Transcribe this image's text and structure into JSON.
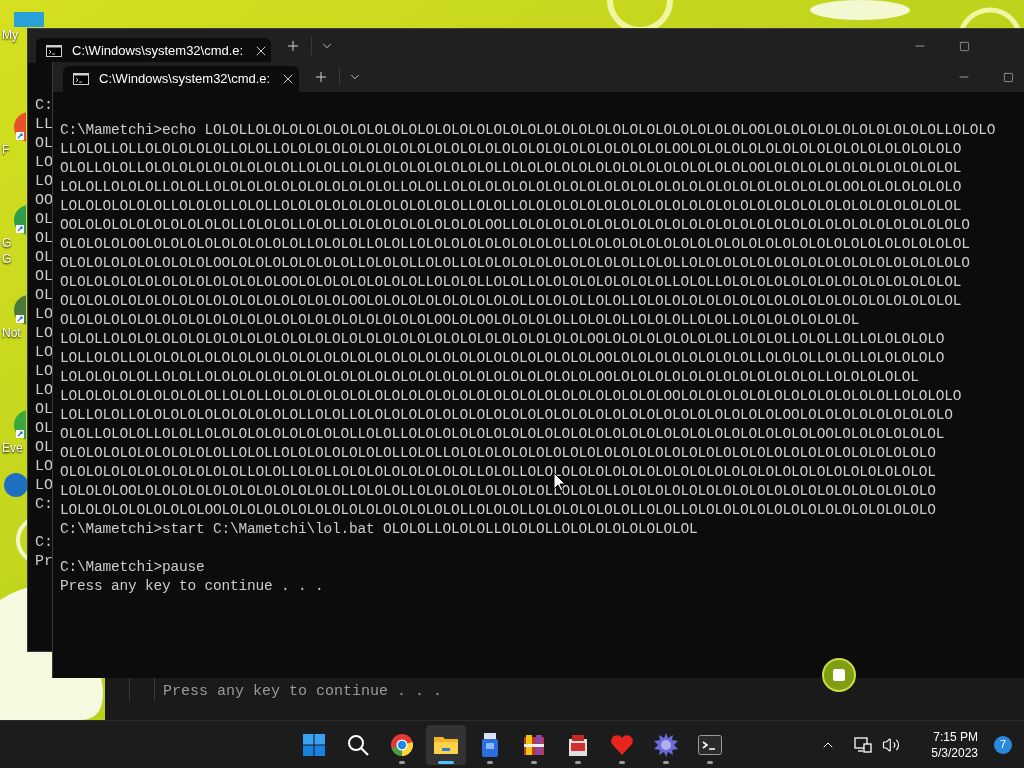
{
  "desktop": {
    "icons": [
      {
        "label": [
          "My"
        ]
      },
      {
        "label": [
          "F"
        ]
      },
      {
        "label": [
          "G",
          "G"
        ]
      },
      {
        "label": [
          "Not"
        ]
      },
      {
        "label": [
          "Eve"
        ]
      }
    ]
  },
  "windows": [
    {
      "tab": {
        "title": "C:\\Windows\\system32\\cmd.e:",
        "selected": true
      },
      "output": [
        [
          "C:",
          "LL",
          "OL",
          "LO",
          "LO",
          "OO",
          "OL",
          "OL",
          "OL",
          "OL",
          "OL",
          "LO",
          "LO",
          "LO",
          "LO",
          "LO",
          "OL",
          "OL",
          "OL",
          "LO",
          "LO",
          "C:"
        ],
        [
          "C:",
          "Pr"
        ]
      ]
    },
    {
      "tab": {
        "title": "C:\\Windows\\system32\\cmd.e:",
        "selected": true
      },
      "output": [
        [
          "C:\\Mametchi>echo LOLOLLOLOLOLOLOLOLOLOLOLOLOLOLOLOLOLOLOLOLOLOLOLOLOLOLOLOLOLOLOLOOLOLOLOLOLOLOLOLOLOLOLLOLOLO",
          "LLOLOLLOLLOLOLOLOLOLLOLOLLOLOLOLOLOLOLOLOLOLOLOLOLOLOLOLOLOLOLOLOLOLOLOLOOLOLOLOLOLOLOLOLOLOLOLOLOLOLOLOLO",
          "OLOLLOLOLLOLOLOLOLOLOLOLOLOLLOLOLLOLOLOLOLOLOLOLOLOLLOLOLOLOLOLOLOLOLOLOLOLOLOLOLOOLOLOLOLOLOLOLOLOLOLOLOL",
          "LOLOLLOLOLOLLOLOLLOLOLOLOLOLOLOLOLOLOLOLLOLOLLOLOLOLOLOLOLOLOLOLOLOLOLOLOLOLOLOLOLOLOLOLOLOLOOLOLOLOLOLOLO",
          "LOLOLOLOLOLOLLOLOLOLLOLOLLOLOLOLOLOLOLOLOLOLOLOLLOLOLLOLOLOLOLOLOLOLOLOLOLOLOLOLOLOLOLOLOLOLOLOLOLOLOLOLOL",
          "OOLOLOLOLOLOLOLOLOLOLLOLOLOLLOLOLLOLOLOLOLOLOLOLOLOOLLOLOLOLOLOLOLOLOLOLOLOLOLOLOLOLOLOLOLOLOLOLOLOLOLOLOLO",
          "OLOLOLOLOOLOLOLOLOLOLOLOLOLOLLOLOLOLLOLOLLOLOLOLOLOLOLOLOLOLLOLOLOLOLOLOLOLOLOLOLOLOLOLOLOLOLOLOLOLOLOLOLOL",
          "OLOLOLOLOLOLOLOLOLOOLOLOLOLOLOLOLOLLOLOLOLLOLOLLOLOLOLOLOLOLOLOLOLOLLOLOLLOLOLOLOLOLOLOLOLOLOLOLOLOLOLOLOLO",
          "OLOLOLOLOLOLOLOLOLOLOLOLOLOOLOLOLOLOLOLOLOLLOLOLOLLOLOLLOLOLOLOLOLOLOLOLLOLOLLOLOLOLOLOLOLOLOLOLOLOLOLOLOL",
          "OLOLOLOLOLOLOLOLOLOLOLOLOLOLOLOLOLOOLOLOLOLOLOLOLOLOLOLLOLOLOLLOLOLLOLOLOLOLOLOLOLOLOLOLOLOLOLOLOLOLOLOLOL",
          "OLOLOLOLOLOLOLOLOLOLOLOLOLOLOLOLOLOLOLOLOLOLOOLOLOOLOLOLOLOLLOLOLOLLOLOLOLLOLOLLOLOLOLOLOLOLOL",
          "LOLOLLOLOLOLOLOLOLOLOLOLOLOLOLOLOLOLOLOLOLOLOLOLOLOLOLOLOLOLOLOOLOLOLOLOLOLOLOLLOLOLOLLOLOLLOLLOLOLOLOLO",
          "LOLLOLOLLOLOLOLOLOLOLOLOLOLOLOLOLOLOLOLOLOLOLOLOLOLOLOLOLOLOLOLOOLOLOLOLOLOLOLOLOLLOLOLOLLOLOLLOLOLOLOLO",
          "LOLOLOLOLOLLOLOLLOLOLOLOLOLOLOLOLOLOLOLOLOLOLOLOLOLOLOLOLOLOLOLOOLOLOLOLOLOLOLOLOLOLOLOLOLLOLOLOLOLOL",
          "LOLOLOLOLOLOLOLOLOLLOLOLLOLOLOLOLOLOLOLOLOLOLOLOLOLOLOLOLOLOLOLOLOLOLOLOOLOLOLOLOLOLOLOLOLOLOLOLOLLOLOLOLO",
          "LOLLOLOLLOLOLOLOLOLOLOLOLOLOLLOLOLLOLOLOLOLOLOLOLOLOLOLOLOLOLOLOLOLOLOLOLOLOLOLOLOLOLOOLOLOLOLOLOLOLOLOLO",
          "OLOLLOLOLOLLOLOLLOLOLOLOLOLOLOLOLOLLOLOLLOLOLOLOLOLOLOLOLOLOLOLOLOLOLOLOLOLOLOLOLOLOLOLOLOOLOLOLOLOLOLOL",
          "OLOLOLOLOLOLOLOLOLOLLOLOLLOLOLOLOLOLOLOLLOLOLLOLOLOLOLOLOLOLOLOLOLOLOLOLOLOLOLOLOLOLOLOLOLOLOLOLOLOLOLO",
          "OLOLOLOLOLOLOLOLOLOLOLLOLOLLOLOLLOLOLOLOLOLOLOLOLLOLOLLOLOLOLOLOLOLOLOLOLOLOLOLOLOLOLOLOLOLOLOLOLOLOLOL",
          "LOLOLOLOOLOLOLOLOLOLOLOLOLOLOLOLOLLOLOLOLLOLOLOLOLOLOLOLOLLOLOLOLLOLOLOLOLOLOLOLOLOLOLOLOLOLOLOLOLOLOLO",
          "LOLOLOLOLOLOLOLOLOOLOLOLOLOLOLOLOLOLOLOLOLOLOLOLLOLOLOLLOLOLOLOLOLOLLOLOLLOLOLOLOLOLOLOLOLOLOLOLOLOLOLO",
          "C:\\Mametchi>start C:\\Mametchi\\lol.bat OLOLOLLOLOLOLLOLOLOLLOLOLOLOLOLOLOLOL"
        ],
        [
          "C:\\Mametchi>pause",
          "Press any key to continue . . ."
        ]
      ]
    },
    {
      "output": [
        [
          "Press any key to continue . . ."
        ]
      ]
    }
  ],
  "taskbar": {
    "apps": [
      {
        "kind": "start",
        "selected": false,
        "running": false
      },
      {
        "kind": "search",
        "selected": false,
        "running": false
      },
      {
        "kind": "browser",
        "selected": false,
        "running": true
      },
      {
        "kind": "folder",
        "selected": true,
        "running": true
      },
      {
        "kind": "drive",
        "selected": false,
        "running": true
      },
      {
        "kind": "archive",
        "selected": false,
        "running": true
      },
      {
        "kind": "toolbox",
        "selected": false,
        "running": true
      },
      {
        "kind": "heart",
        "selected": false,
        "running": true
      },
      {
        "kind": "gear",
        "selected": false,
        "running": true
      },
      {
        "kind": "terminal",
        "selected": false,
        "running": true
      }
    ],
    "time": "7:15 PM",
    "date": "5/3/2023",
    "notifications": "7"
  }
}
